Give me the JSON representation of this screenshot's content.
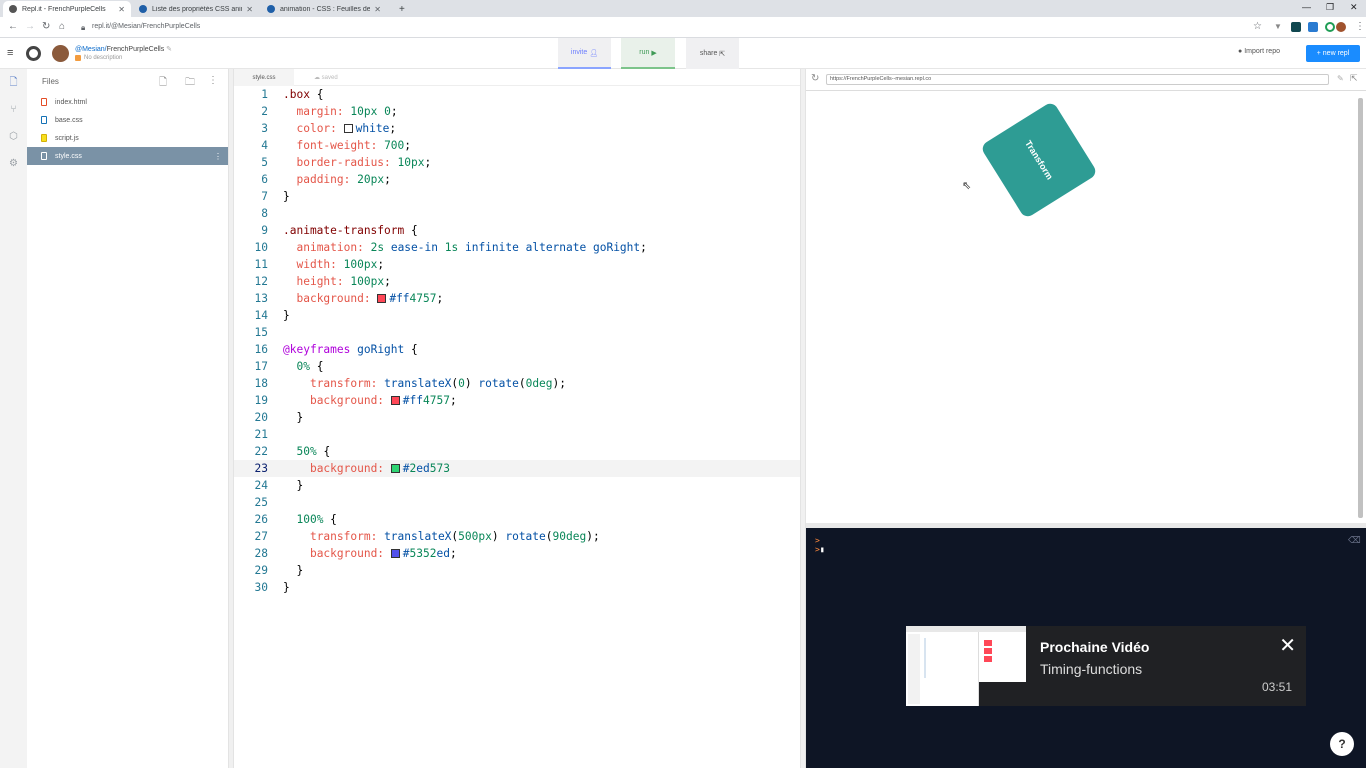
{
  "browser": {
    "tabs": [
      {
        "title": "Repl.it - FrenchPurpleCells",
        "active": true
      },
      {
        "title": "Liste des propriétés CSS animé",
        "active": false
      },
      {
        "title": "animation - CSS : Feuilles de styl",
        "active": false
      }
    ],
    "new_tab": "+",
    "url": "repl.it/@Mesian/FrenchPurpleCells"
  },
  "header": {
    "user": "@Mesian",
    "repl_name": "FrenchPurpleCells",
    "description": "No description",
    "invite_label": "invite",
    "run_label": "run",
    "share_label": "share",
    "import_label": "Import repo",
    "new_repl_label": "+ new repl"
  },
  "sidebar": {
    "title": "Files",
    "files": [
      {
        "name": "index.html",
        "color": "#e44d26"
      },
      {
        "name": "base.css",
        "color": "#1572b6"
      },
      {
        "name": "script.js",
        "color": "#d4b106"
      },
      {
        "name": "style.css",
        "color": "#ffffff",
        "selected": true
      }
    ]
  },
  "editor": {
    "tab": "style.css",
    "status": "saved",
    "current_line": 23,
    "lines": [
      ".box {",
      "  margin: 10px 0;",
      "  color: white;",
      "  font-weight: 700;",
      "  border-radius: 10px;",
      "  padding: 20px;",
      "}",
      "",
      ".animate-transform {",
      "  animation: 2s ease-in 1s infinite alternate goRight;",
      "  width: 100px;",
      "  height: 100px;",
      "  background: #ff4757;",
      "}",
      "",
      "@keyframes goRight {",
      "  0% {",
      "    transform: translateX(0) rotate(0deg);",
      "    background: #ff4757;",
      "  }",
      "",
      "  50% {",
      "    background: #2ed573",
      "  }",
      "",
      "  100% {",
      "    transform: translateX(500px) rotate(90deg);",
      "    background: #5352ed;",
      "  }",
      "}"
    ]
  },
  "preview": {
    "url": "https://FrenchPurpleCells--mesian.repl.co",
    "box_label": "Transform",
    "box_color": "#2e9c94"
  },
  "console": {
    "prompt": ">"
  },
  "next_video": {
    "label": "Prochaine Vidéo",
    "title": "Timing-functions",
    "duration": "03:51"
  },
  "help": "?"
}
